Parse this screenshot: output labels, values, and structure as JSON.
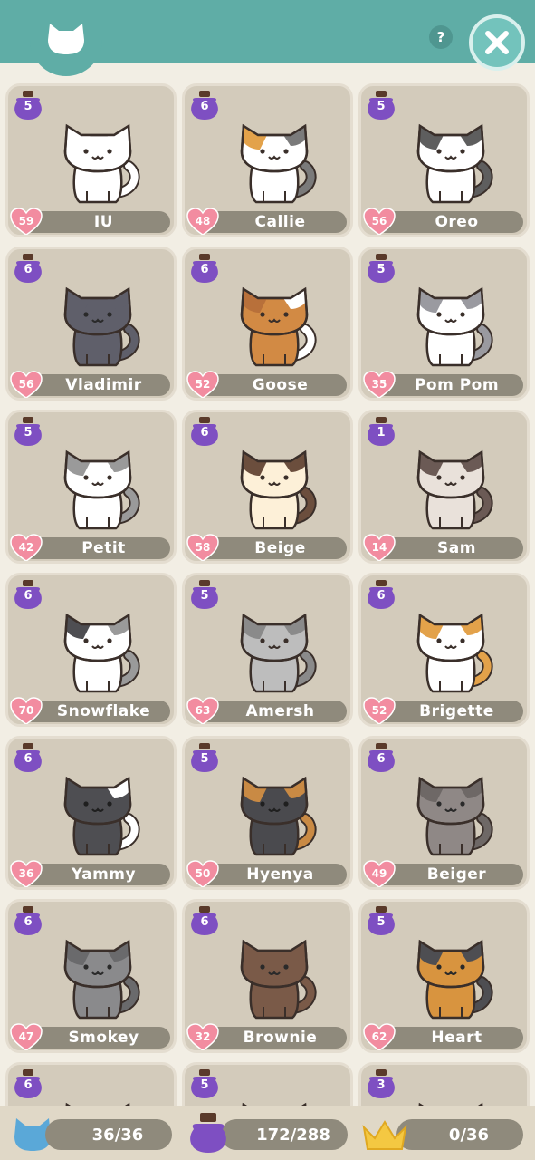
{
  "header": {
    "tab_icon": "cat-head-icon",
    "help_label": "?",
    "close_icon": "close-icon"
  },
  "cats": [
    {
      "name": "IU",
      "coins": "5",
      "hearts": "59",
      "body": "#ffffff",
      "accent": "#ffffff",
      "accent2": "#ffffff",
      "eyes": "#3a2f2a"
    },
    {
      "name": "Callie",
      "coins": "6",
      "hearts": "48",
      "body": "#ffffff",
      "accent": "#e3a24a",
      "accent2": "#7a7a7a",
      "eyes": "#3a2f2a"
    },
    {
      "name": "Oreo",
      "coins": "5",
      "hearts": "56",
      "body": "#ffffff",
      "accent": "#5e5e5e",
      "accent2": "#5e5e5e",
      "eyes": "#3a2f2a"
    },
    {
      "name": "Vladimir",
      "coins": "6",
      "hearts": "56",
      "body": "#5f5f6a",
      "accent": "#5f5f6a",
      "accent2": "#5f5f6a",
      "eyes": "#2a2a2a"
    },
    {
      "name": "Goose",
      "coins": "6",
      "hearts": "52",
      "body": "#d28a44",
      "accent": "#b8703a",
      "accent2": "#ffffff",
      "eyes": "#3a2f2a"
    },
    {
      "name": "Pom Pom",
      "coins": "5",
      "hearts": "35",
      "body": "#ffffff",
      "accent": "#9a9aa0",
      "accent2": "#9a9aa0",
      "eyes": "#3a2f2a"
    },
    {
      "name": "Petit",
      "coins": "5",
      "hearts": "42",
      "body": "#ffffff",
      "accent": "#9a9a9a",
      "accent2": "#9a9a9a",
      "eyes": "#3a2f2a"
    },
    {
      "name": "Beige",
      "coins": "6",
      "hearts": "58",
      "body": "#fdf0d8",
      "accent": "#6b4e3d",
      "accent2": "#6b4e3d",
      "eyes": "#3a2f2a"
    },
    {
      "name": "Sam",
      "coins": "1",
      "hearts": "14",
      "body": "#e9e1da",
      "accent": "#6b5a55",
      "accent2": "#6b5a55",
      "eyes": "#3a2f2a"
    },
    {
      "name": "Snowflake",
      "coins": "6",
      "hearts": "70",
      "body": "#ffffff",
      "accent": "#4e4e52",
      "accent2": "#9a9a9a",
      "eyes": "#3a2f2a"
    },
    {
      "name": "Amersh",
      "coins": "5",
      "hearts": "63",
      "body": "#bdbdbd",
      "accent": "#8a8a8a",
      "accent2": "#8a8a8a",
      "eyes": "#3a2f2a"
    },
    {
      "name": "Brigette",
      "coins": "6",
      "hearts": "52",
      "body": "#ffffff",
      "accent": "#e3a24a",
      "accent2": "#e3a24a",
      "eyes": "#3a2f2a"
    },
    {
      "name": "Yammy",
      "coins": "6",
      "hearts": "36",
      "body": "#4e4e52",
      "accent": "#4e4e52",
      "accent2": "#ffffff",
      "eyes": "#1f1f1f"
    },
    {
      "name": "Hyenya",
      "coins": "5",
      "hearts": "50",
      "body": "#4a4a4e",
      "accent": "#c98a44",
      "accent2": "#c98a44",
      "eyes": "#1f1f1f"
    },
    {
      "name": "Beiger",
      "coins": "6",
      "hearts": "49",
      "body": "#8f8886",
      "accent": "#6e6866",
      "accent2": "#6e6866",
      "eyes": "#2a2a2a"
    },
    {
      "name": "Smokey",
      "coins": "6",
      "hearts": "47",
      "body": "#8a8a8c",
      "accent": "#6a6a6c",
      "accent2": "#6a6a6c",
      "eyes": "#2a2a2a"
    },
    {
      "name": "Brownie",
      "coins": "6",
      "hearts": "32",
      "body": "#7a5a48",
      "accent": "#7a5a48",
      "accent2": "#7a5a48",
      "eyes": "#2a2a2a"
    },
    {
      "name": "Heart",
      "coins": "5",
      "hearts": "62",
      "body": "#d8943f",
      "accent": "#4e4e52",
      "accent2": "#4e4e52",
      "eyes": "#2a2a2a"
    },
    {
      "name": "",
      "coins": "6",
      "hearts": "",
      "body": "#4e4e52",
      "accent": "#4e4e52",
      "accent2": "#4e4e52",
      "eyes": "#2a2a2a"
    },
    {
      "name": "",
      "coins": "5",
      "hearts": "",
      "body": "#d8943f",
      "accent": "#d8943f",
      "accent2": "#d8943f",
      "eyes": "#2a2a2a"
    },
    {
      "name": "",
      "coins": "3",
      "hearts": "",
      "body": "#8a8a8c",
      "accent": "#8a8a8c",
      "accent2": "#8a8a8c",
      "eyes": "#2a2a2a"
    }
  ],
  "footer": {
    "cats_count": "36/36",
    "coins_count": "172/288",
    "crowns_count": "0/36"
  },
  "colors": {
    "header_teal": "#5fada6",
    "coin_purple": "#7e4fc2",
    "heart_pink": "#f28ca0",
    "crown_gold": "#f4c842"
  }
}
